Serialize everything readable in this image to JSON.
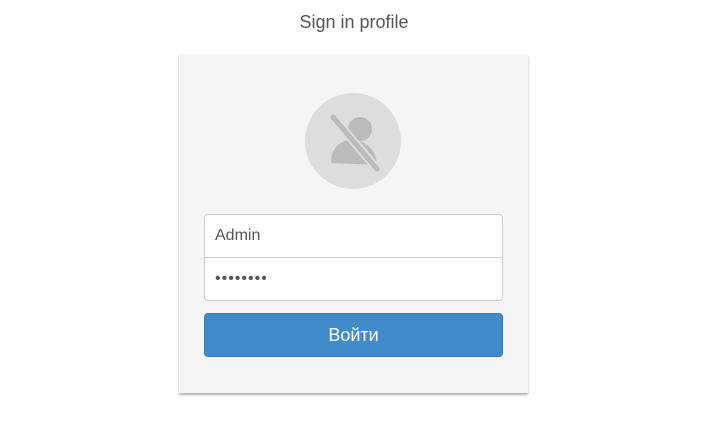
{
  "page": {
    "title": "Sign in profile"
  },
  "form": {
    "avatar_icon": "user-slash-icon",
    "username_value": "Admin",
    "password_value": "12345678",
    "submit_label": "Войти"
  },
  "colors": {
    "card_bg": "#f5f5f5",
    "button_bg": "#428bca",
    "avatar_bg": "#dddddd",
    "avatar_fg": "#bbbbbb"
  }
}
